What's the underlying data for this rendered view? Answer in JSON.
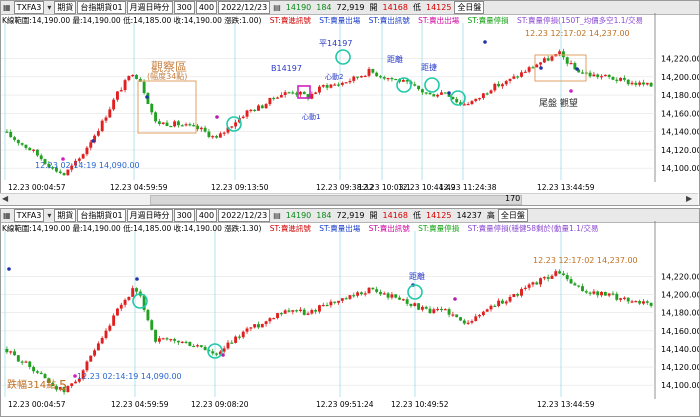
{
  "toolbar": {
    "symbol": "TXFA3",
    "field1": "期貨",
    "field2": "台指期貨01",
    "period": "月週日時分",
    "interval": "300",
    "bars": "400",
    "date": "2022/12/23",
    "price": "14190",
    "change": "184",
    "volume": "72,919",
    "open_label": "開",
    "high_val": "14237",
    "high_label": "高",
    "low_val": "14168",
    "low_label": "低",
    "close_val": "14125",
    "session": "全日盤"
  },
  "panel1": {
    "info": [
      "K線範圍:14,190.00 最:14,190.00 低:14,185.00 收:14,190.00 漲跌:1.00)",
      "ST:賣進訊號",
      "ST:賣量出場",
      "ST:賣出訊號",
      "ST:賣出出場",
      "ST:賣量停損",
      "ST:賣量停損(150T_均價多空1.1/交易"
    ],
    "axis_prices": [
      "14,220.00",
      "14,200.00",
      "14,180.00",
      "14,160.00",
      "14,140.00",
      "14,120.00",
      "14,100.00"
    ],
    "axis_times": [
      "12.23 00:04:57",
      "12.23 04:59:59",
      "12.23 09:13:50",
      "12.23 09:38:32",
      "12.23 10:03:1",
      "12.23 10:44:49",
      "12.23 11:24:38",
      "12.23 13:44:59"
    ],
    "annotations": {
      "observe_title": "觀察區",
      "observe_sub": "(幅度34點)",
      "low_note": "12.23 02:14:19  14,090.00",
      "high_note": "12.23 12:17:02  14,237.00",
      "b_label": "B14197",
      "ping_label": "平14197",
      "heart1": "心動1",
      "heart2": "心動2",
      "mid_label": "距離",
      "mid_label2": "距捷",
      "tail_label": "尾盤 觀望"
    }
  },
  "panel2": {
    "scroll_value": "170",
    "info": [
      "K線範圍:14,190.00 最:14,190.00 低:14,185.00 收:14,190.00 漲跌:1.30)",
      "ST:賣進訊號",
      "ST:賣量出場",
      "ST:賣出訊號",
      "ST:賣量停損",
      "ST:賣量停損(穩健58剩於(動量1.1/交易"
    ],
    "axis_prices": [
      "14,220.00",
      "14,200.00",
      "14,180.00",
      "14,160.00",
      "14,140.00",
      "14,120.00",
      "14,100.00"
    ],
    "axis_times": [
      "12.23 00:04:57",
      "12.23 04:59:59",
      "12.23 09:08:20",
      "12.23 09:51:24",
      "12.23 10:49:52",
      "12.23 13:44:59"
    ],
    "annotations": {
      "high_note": "12.23 12:17:02  14,237.00",
      "low_note": "12.23 02:14:19  14,090.00",
      "drop_label": "跌幅314點",
      "drop_num": "5",
      "mid_label": "距離"
    }
  }
}
